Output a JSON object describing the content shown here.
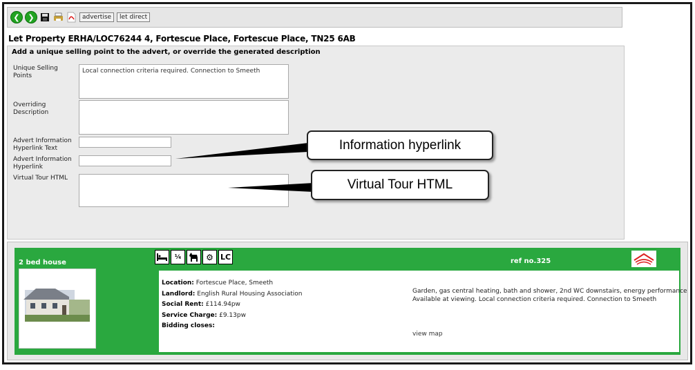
{
  "toolbar": {
    "buttons": [
      {
        "icon": "back-arrow-icon",
        "glyph": "❮"
      },
      {
        "icon": "forward-arrow-icon",
        "glyph": "❯"
      },
      {
        "icon": "save-disk-icon"
      },
      {
        "icon": "print-icon"
      },
      {
        "icon": "pdf-icon"
      }
    ],
    "advertise_label": "advertise",
    "let_direct_label": "let direct"
  },
  "page_title": "Let  Property ERHA/LOC76244 4, Fortescue Place, Fortescue Place, TN25 6AB",
  "form": {
    "header": "Add a unique selling point to the advert, or override the generated description",
    "unique_selling_label": "Unique Selling Points",
    "unique_selling_value": "Local connection criteria required. Connection to Smeeth",
    "overriding_label": "Overriding Description",
    "overriding_value": "",
    "advert_link_text_label": "Advert Information Hyperlink Text",
    "advert_link_text_value": "",
    "advert_link_label": "Advert Information Hyperlink",
    "advert_link_value": "",
    "virtual_tour_label": "Virtual Tour HTML",
    "virtual_tour_value": ""
  },
  "callouts": {
    "info_hyperlink": "Information hyperlink",
    "virtual_tour": "Virtual Tour HTML"
  },
  "listing": {
    "heading": "2 bed house",
    "ref": "ref no.325",
    "icons": [
      {
        "name": "bed-icon",
        "glyph": "🛏"
      },
      {
        "name": "age-restriction-icon",
        "glyph": "¹⁄₄"
      },
      {
        "name": "pets-icon",
        "glyph": "🐕"
      },
      {
        "name": "cog-icon",
        "glyph": "⚙"
      },
      {
        "name": "local-connection-icon",
        "glyph": "LC"
      }
    ],
    "brand_color": "#2aa83f",
    "location_label": "Location:",
    "location_value": "Fortescue Place, Smeeth",
    "landlord_label": "Landlord:",
    "landlord_value": "English Rural Housing Association",
    "rent_label": "Social Rent:",
    "rent_value": "£114.94pw",
    "service_label": "Service Charge:",
    "service_value": "£9.13pw",
    "bidding_label": "Bidding closes:",
    "bidding_value": "",
    "features": "Garden, gas central heating, bath and shower, 2nd WC downstairs, energy performance",
    "availability": "Available at viewing. Local connection criteria required. Connection to Smeeth",
    "view_map": "view map"
  }
}
